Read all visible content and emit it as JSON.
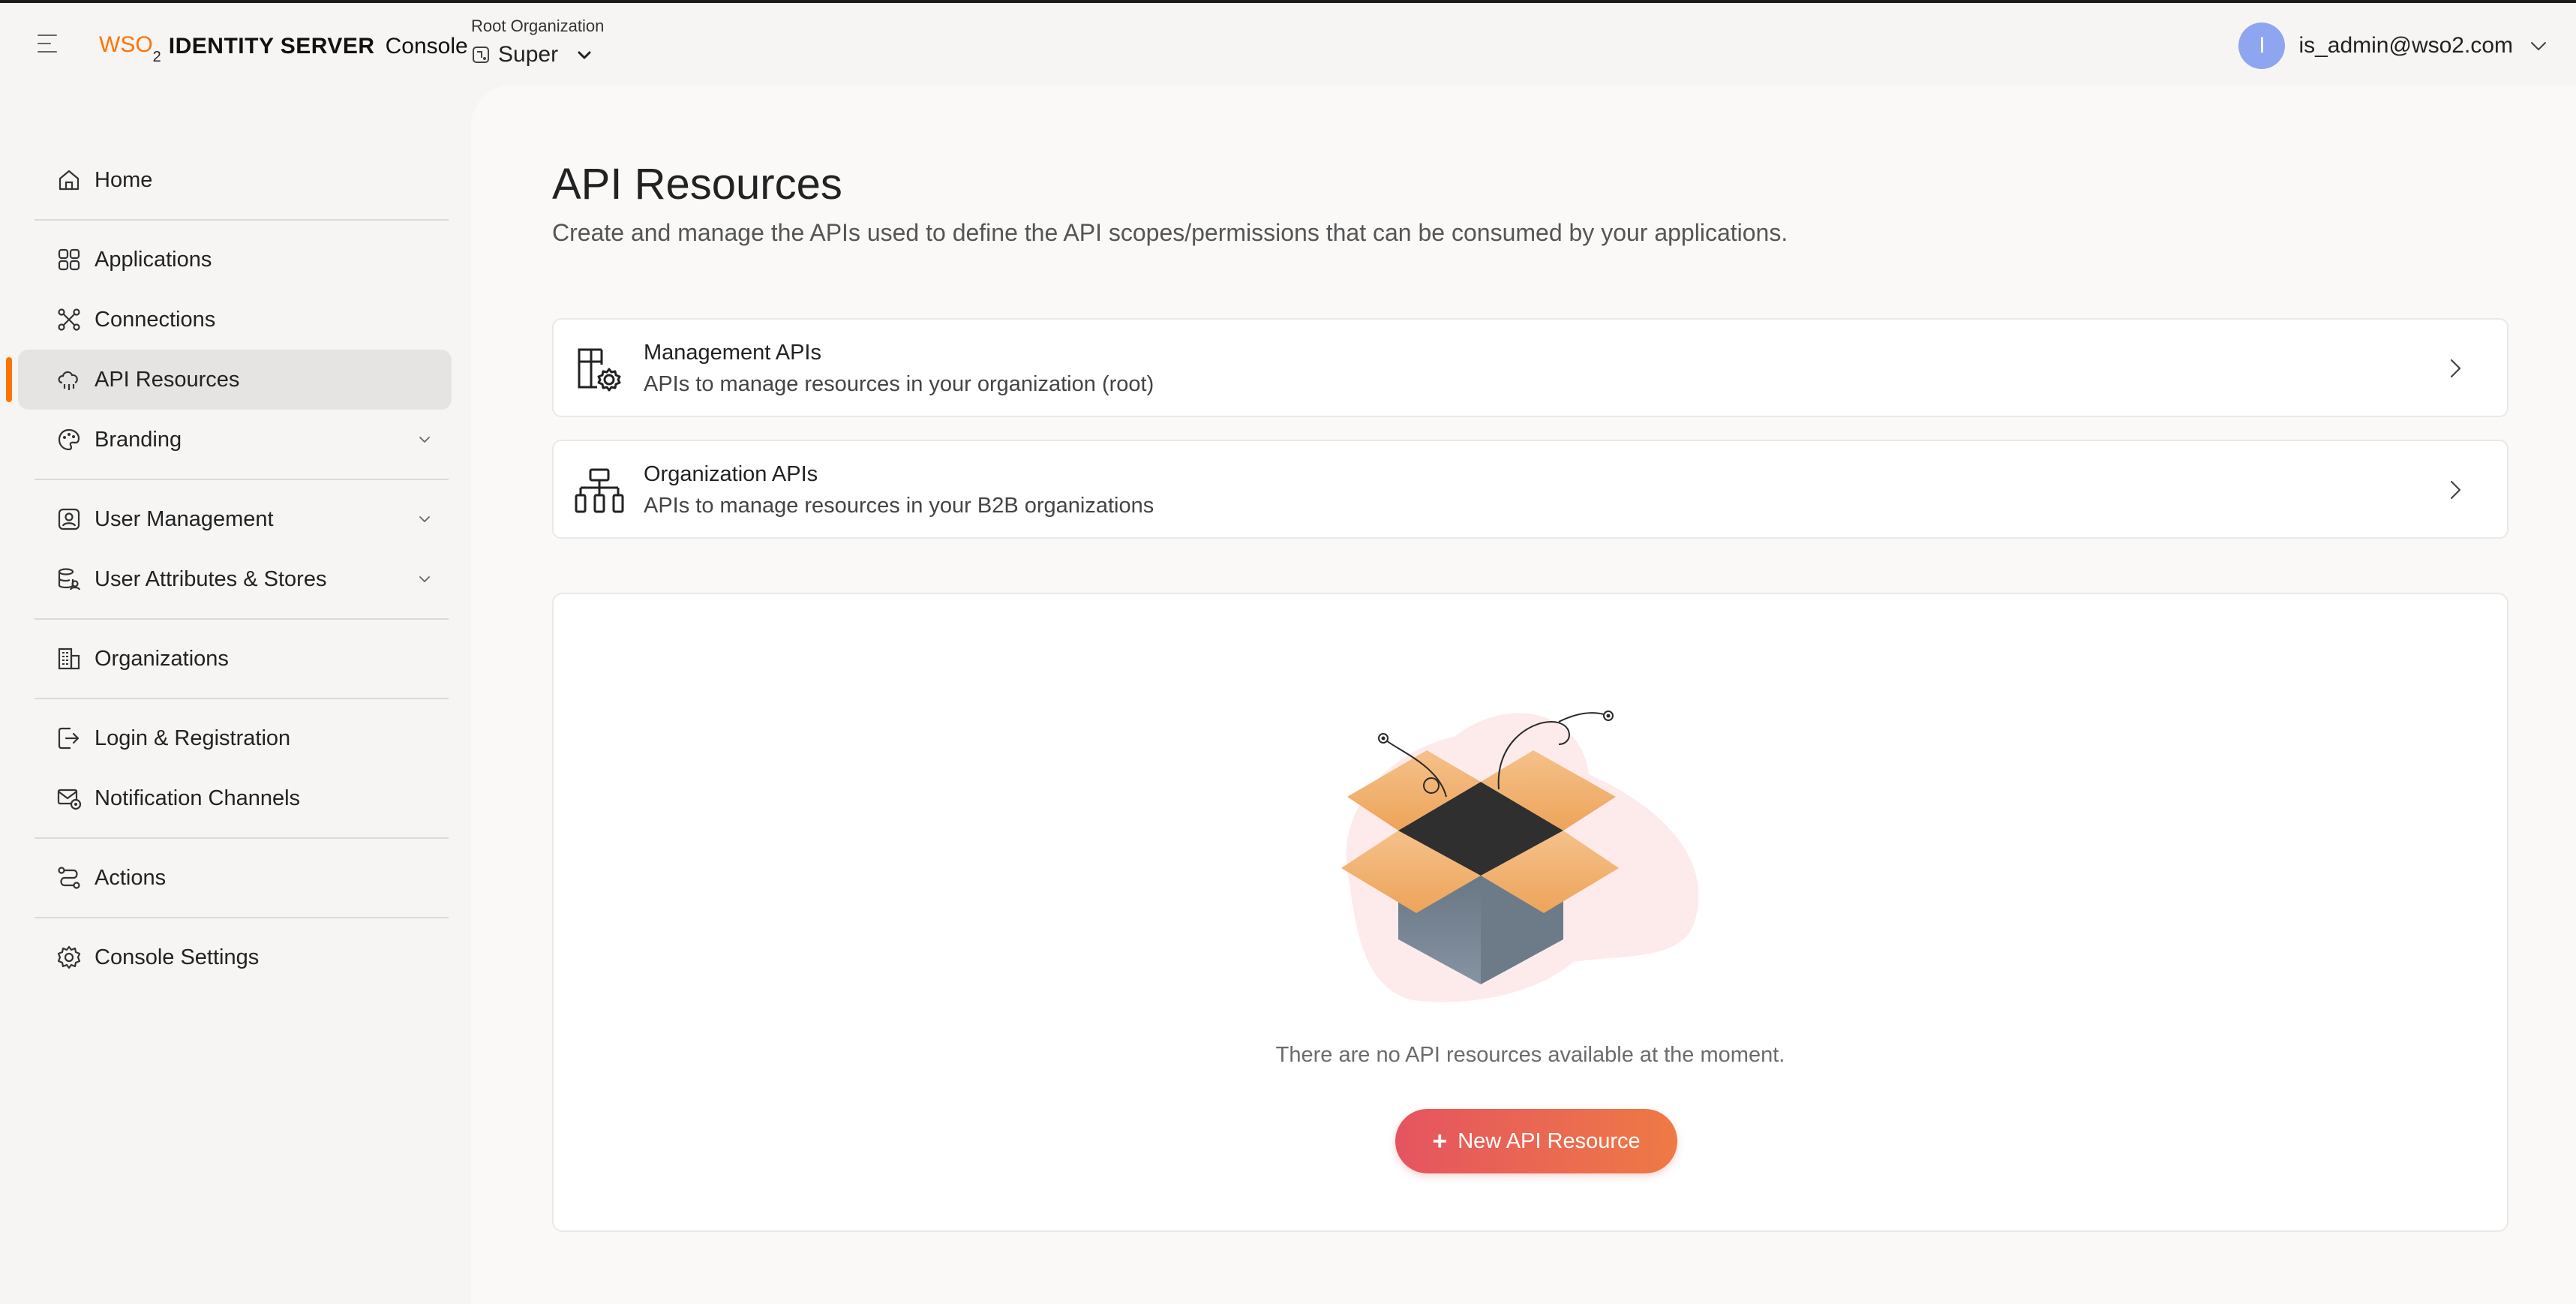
{
  "header": {
    "logo": {
      "brand": "WSO",
      "brand_sub": "2",
      "product": "IDENTITY SERVER",
      "console": "Console"
    },
    "org_label": "Root Organization",
    "org_name": "Super",
    "user_initial": "I",
    "user_email": "is_admin@wso2.com"
  },
  "sidebar": {
    "items": [
      {
        "label": "Home",
        "icon": "home-icon"
      },
      {
        "label": "Applications",
        "icon": "applications-icon"
      },
      {
        "label": "Connections",
        "icon": "connections-icon"
      },
      {
        "label": "API Resources",
        "icon": "api-resources-icon",
        "active": true
      },
      {
        "label": "Branding",
        "icon": "branding-icon",
        "expandable": true
      },
      {
        "label": "User Management",
        "icon": "user-management-icon",
        "expandable": true
      },
      {
        "label": "User Attributes & Stores",
        "icon": "user-attributes-icon",
        "expandable": true
      },
      {
        "label": "Organizations",
        "icon": "organizations-icon"
      },
      {
        "label": "Login & Registration",
        "icon": "login-registration-icon"
      },
      {
        "label": "Notification Channels",
        "icon": "notification-channels-icon"
      },
      {
        "label": "Actions",
        "icon": "actions-icon"
      },
      {
        "label": "Console Settings",
        "icon": "console-settings-icon"
      }
    ]
  },
  "main": {
    "title": "API Resources",
    "description": "Create and manage the APIs used to define the API scopes/permissions that can be consumed by your applications.",
    "cards": [
      {
        "title": "Management APIs",
        "subtitle": "APIs to manage resources in your organization (root)",
        "icon": "management-apis-icon"
      },
      {
        "title": "Organization APIs",
        "subtitle": "APIs to manage resources in your B2B organizations",
        "icon": "organization-apis-icon"
      }
    ],
    "empty_message": "There are no API resources available at the moment.",
    "new_button": "New API Resource"
  },
  "colors": {
    "accent": "#ff7300",
    "button_start": "#e55460",
    "button_end": "#ee7a45",
    "avatar": "#8ea5f0"
  }
}
